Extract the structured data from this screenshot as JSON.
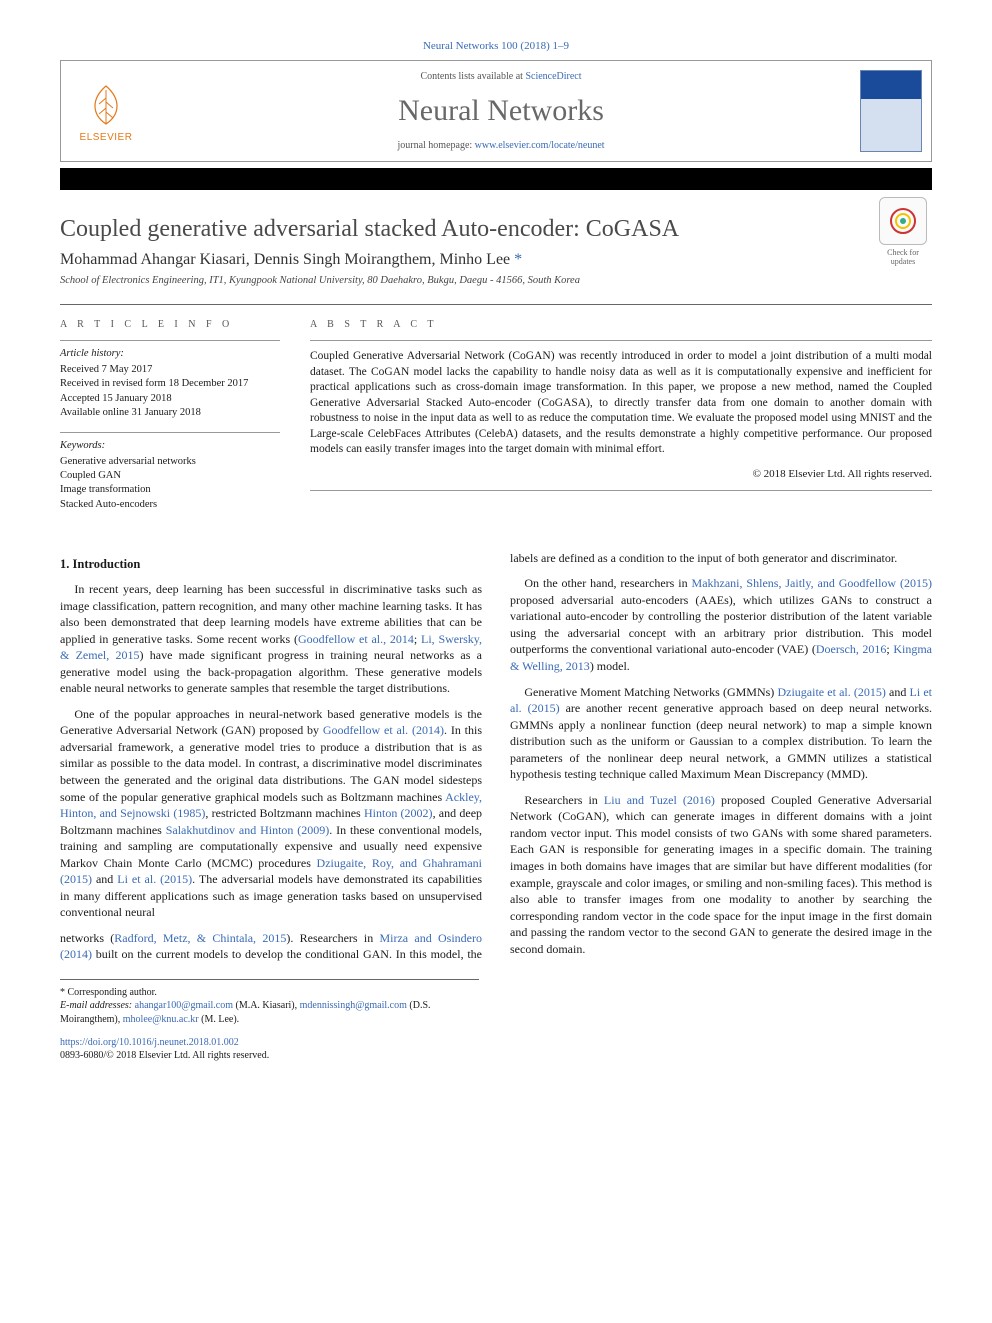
{
  "journal_ref": "Neural Networks 100 (2018) 1–9",
  "header": {
    "contents_prefix": "Contents lists available at ",
    "contents_link": "ScienceDirect",
    "journal_title": "Neural Networks",
    "homepage_prefix": "journal homepage: ",
    "homepage_link": "www.elsevier.com/locate/neunet",
    "publisher_brand": "ELSEVIER"
  },
  "crossmark_label": "Check for updates",
  "article": {
    "title": "Coupled generative adversarial stacked Auto-encoder: CoGASA",
    "authors_html": "Mohammad Ahangar Kiasari, Dennis Singh Moirangthem, Minho Lee",
    "corr_marker": "*",
    "affiliation": "School of Electronics Engineering, IT1, Kyungpook National University, 80 Daehakro, Bukgu, Daegu - 41566, South Korea"
  },
  "info": {
    "heading": "a r t i c l e   i n f o",
    "history_head": "Article history:",
    "history": [
      "Received 7 May 2017",
      "Received in revised form 18 December 2017",
      "Accepted 15 January 2018",
      "Available online 31 January 2018"
    ],
    "keywords_head": "Keywords:",
    "keywords": [
      "Generative adversarial networks",
      "Coupled GAN",
      "Image transformation",
      "Stacked Auto-encoders"
    ]
  },
  "abstract": {
    "heading": "a b s t r a c t",
    "text": "Coupled Generative Adversarial Network (CoGAN) was recently introduced  in order to model a joint distribution of a multi modal dataset. The CoGAN model lacks the capability to handle noisy data as well as it is computationally expensive and inefficient for practical applications such as cross-domain image transformation. In this paper, we propose a new method, named the Coupled Generative Adversarial Stacked Auto-encoder (CoGASA), to directly transfer data from one domain to another domain with robustness to noise in the input data as well to as reduce the computation time. We evaluate the proposed model using MNIST and the Large-scale CelebFaces Attributes (CelebA) datasets, and the results demonstrate a highly competitive performance. Our proposed models can easily transfer images into the target domain with minimal effort.",
    "copyright": "© 2018 Elsevier Ltd. All rights reserved."
  },
  "sections": {
    "s1_title": "1. Introduction",
    "p1a": "In recent years, deep learning has been successful in discriminative tasks such as image classification, pattern recognition, and many other machine learning tasks. It has also been demonstrated that deep learning models have extreme abilities that can be applied in generative tasks. Some recent works (",
    "p1_link1": "Goodfellow et al., 2014",
    "p1b": "; ",
    "p1_link2": "Li, Swersky, & Zemel, 2015",
    "p1c": ") have made significant progress in training neural networks as a generative model using the back-propagation algorithm. These generative models enable neural networks to generate samples that resemble the target distributions.",
    "p2a": "One of the popular approaches in neural-network based generative models is the Generative Adversarial Network (GAN) proposed by ",
    "p2_link1": "Goodfellow et al. (2014)",
    "p2b": ". In this adversarial framework, a generative model tries to produce a distribution that is as similar as possible to the data model. In contrast, a discriminative model discriminates between the generated and the original data distributions. The GAN model sidesteps some of the popular generative graphical models such as Boltzmann machines ",
    "p2_link2": "Ackley, Hinton, and Sejnowski (1985)",
    "p2c": ", restricted Boltzmann machines ",
    "p2_link3": "Hinton (2002)",
    "p2d": ", and deep Boltzmann machines ",
    "p2_link4": "Salakhutdinov and Hinton (2009)",
    "p2e": ". In these conventional models, training and sampling are computationally expensive and usually need expensive Markov Chain Monte Carlo (MCMC) procedures ",
    "p2_link5": "Dziugaite, Roy, and Ghahramani (2015)",
    "p2f": " and ",
    "p2_link6": "Li et al. (2015)",
    "p2g": ". The adversarial models have demonstrated its capabilities in many different applications such as image generation tasks based on unsupervised conventional neural",
    "p3a": "networks (",
    "p3_link1": "Radford, Metz, & Chintala, 2015",
    "p3b": "). Researchers in ",
    "p3_link2": "Mirza and Osindero (2014)",
    "p3c": " built on the current models to develop the conditional GAN. In this model, the labels are defined as a condition to the input of both generator and discriminator.",
    "p4a": "On the other hand, researchers in ",
    "p4_link1": "Makhzani, Shlens, Jaitly, and Goodfellow (2015)",
    "p4b": " proposed adversarial auto-encoders (AAEs), which utilizes GANs to construct a variational auto-encoder by controlling the posterior distribution of the latent variable using the adversarial concept with an arbitrary prior distribution. This model outperforms the conventional variational auto-encoder (VAE) (",
    "p4_link2": "Doersch, 2016",
    "p4c": "; ",
    "p4_link3": "Kingma & Welling, 2013",
    "p4d": ") model.",
    "p5a": "Generative Moment Matching Networks (GMMNs) ",
    "p5_link1": "Dziugaite et al. (2015)",
    "p5b": " and ",
    "p5_link2": "Li et al. (2015)",
    "p5c": " are another recent generative approach based on deep neural networks. GMMNs apply a nonlinear function (deep neural network) to map a simple known distribution such as the uniform or Gaussian to a complex distribution. To learn the parameters of the nonlinear deep neural network, a GMMN utilizes a statistical hypothesis testing technique called Maximum Mean Discrepancy (MMD).",
    "p6a": "Researchers in ",
    "p6_link1": "Liu and Tuzel (2016)",
    "p6b": " proposed Coupled Generative Adversarial Network (CoGAN), which can generate images in different domains with a joint random vector input. This model consists of two GANs with some shared parameters. Each GAN is responsible for generating images in a specific domain. The training images in both domains have images that are similar but have different modalities (for example, grayscale and color images, or smiling and non-smiling faces). This method is also able to transfer images from one modality to another by searching the corresponding random vector in the code space for the input image in the first domain and passing the random vector to the second GAN to generate the desired image in the second domain."
  },
  "footnotes": {
    "corr": "* Corresponding author.",
    "emails_label": "E-mail addresses:",
    "e1": "ahangar100@gmail.com",
    "e1_name": " (M.A. Kiasari), ",
    "e2": "mdennissingh@gmail.com",
    "e2_name": " (D.S. Moirangthem), ",
    "e3": "mholee@knu.ac.kr",
    "e3_name": " (M. Lee)."
  },
  "doi": {
    "link": "https://doi.org/10.1016/j.neunet.2018.01.002",
    "issn_line": "0893-6080/© 2018 Elsevier Ltd. All rights reserved."
  }
}
